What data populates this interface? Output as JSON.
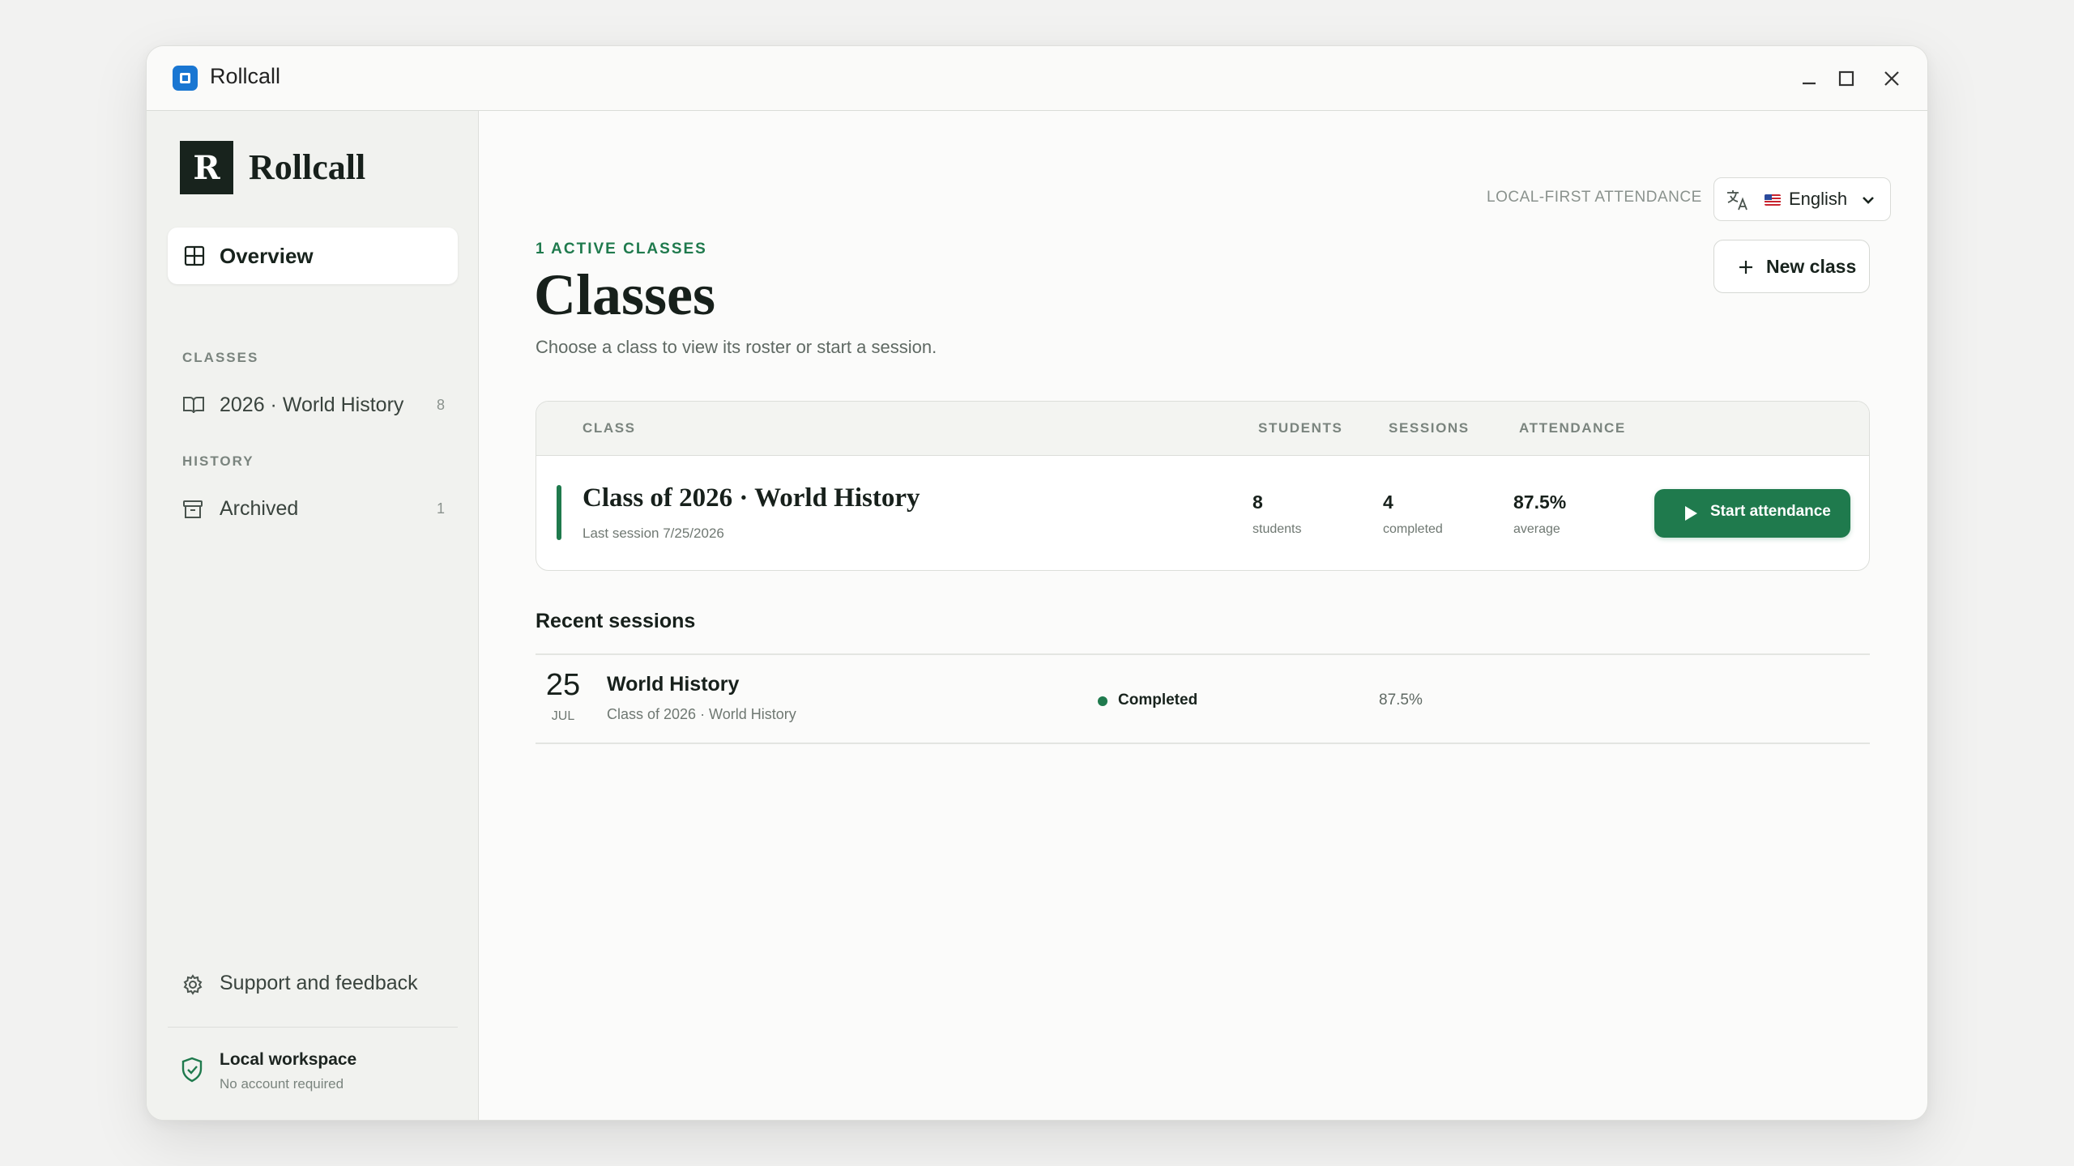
{
  "window": {
    "title": "Rollcall"
  },
  "sidebar": {
    "brand_mark": "R",
    "brand_name": "Rollcall",
    "overview_label": "Overview",
    "sections": {
      "classes": "CLASSES",
      "history": "HISTORY"
    },
    "classes_items": [
      {
        "label": "2026 · World History",
        "count": "8",
        "icon": "book-icon"
      }
    ],
    "history_items": [
      {
        "label": "Archived",
        "count": "1",
        "icon": "archive-icon"
      }
    ],
    "support_label": "Support and feedback",
    "workspace": {
      "title": "Local workspace",
      "subtitle": "No account required"
    }
  },
  "header": {
    "tagline": "LOCAL-FIRST ATTENDANCE",
    "language": "English",
    "eyebrow": "1 ACTIVE CLASSES",
    "title": "Classes",
    "subtitle": "Choose a class to view its roster or start a session.",
    "new_class_label": "New class"
  },
  "class_table": {
    "columns": [
      "CLASS",
      "STUDENTS",
      "SESSIONS",
      "ATTENDANCE"
    ],
    "rows": [
      {
        "name": "Class of 2026 · World History",
        "last_session": "Last session 7/25/2026",
        "students_value": "8",
        "students_label": "students",
        "sessions_value": "4",
        "sessions_label": "completed",
        "attendance_value": "87.5%",
        "attendance_label": "average",
        "action_label": "Start attendance"
      }
    ]
  },
  "recent_sessions": {
    "title": "Recent sessions",
    "items": [
      {
        "day": "25",
        "month": "JUL",
        "title": "World History",
        "subtitle": "Class of 2026 · World History",
        "status": "Completed",
        "attendance": "87.5%"
      }
    ]
  },
  "colors": {
    "accent": "#1f7a4d",
    "brand_dark": "#18231d",
    "app_icon": "#1976d2",
    "sidebar_bg": "#f1f2ef",
    "page_bg": "#fbfbfa"
  }
}
